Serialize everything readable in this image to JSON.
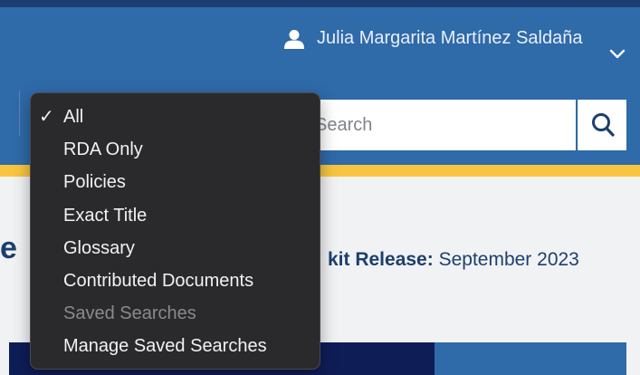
{
  "user": {
    "name": "Julia Margarita Martínez Saldaña"
  },
  "search": {
    "placeholder": "Search",
    "scope_options": [
      {
        "label": "All",
        "selected": true,
        "disabled": false
      },
      {
        "label": "RDA Only",
        "selected": false,
        "disabled": false
      },
      {
        "label": "Policies",
        "selected": false,
        "disabled": false
      },
      {
        "label": "Exact Title",
        "selected": false,
        "disabled": false
      },
      {
        "label": "Glossary",
        "selected": false,
        "disabled": false
      },
      {
        "label": "Contributed Documents",
        "selected": false,
        "disabled": false
      },
      {
        "label": "Saved Searches",
        "selected": false,
        "disabled": true
      },
      {
        "label": "Manage Saved Searches",
        "selected": false,
        "disabled": false
      }
    ],
    "check_glyph": "✓",
    "button_icon": "search-icon"
  },
  "content": {
    "heading_fragment": "e",
    "release_label": "kit Release:",
    "release_value": "September 2023"
  },
  "colors": {
    "header": "#2f6aa9",
    "accent_yellow": "#f7c540",
    "navy": "#0f1d57",
    "menu_bg": "#2a2a2d"
  }
}
